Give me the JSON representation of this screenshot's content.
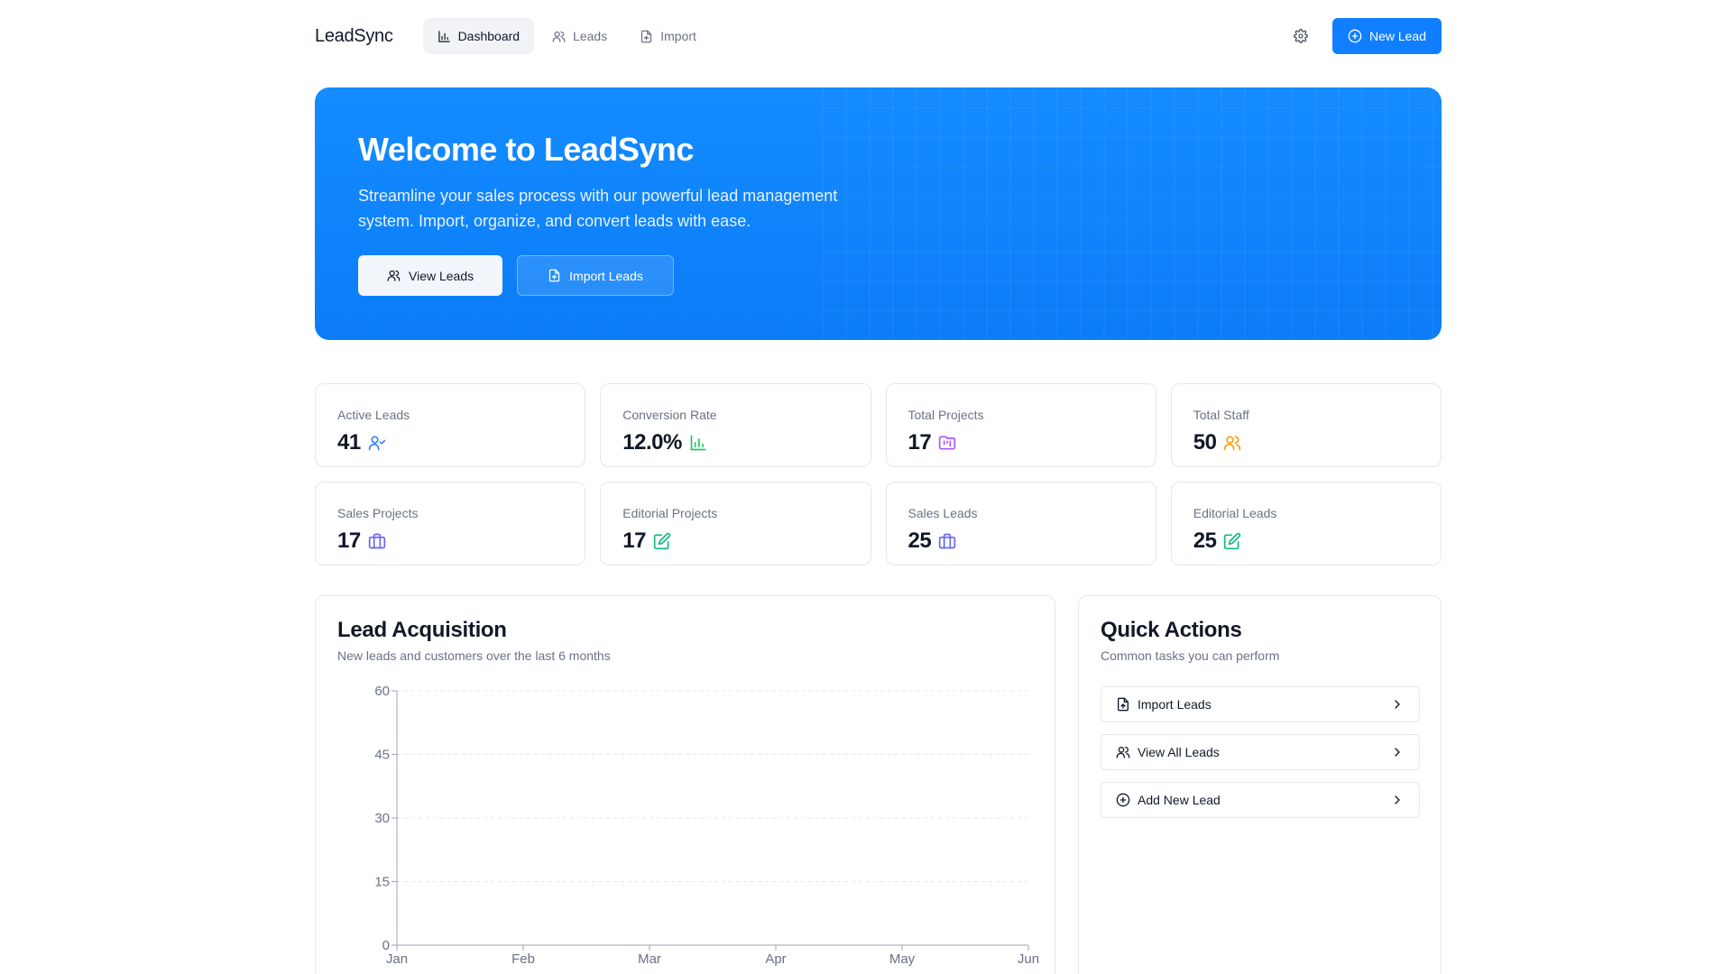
{
  "nav": {
    "brand": "LeadSync",
    "tabs": [
      {
        "label": "Dashboard",
        "icon": "bar-chart-icon",
        "active": true
      },
      {
        "label": "Leads",
        "icon": "users-icon",
        "active": false
      },
      {
        "label": "Import",
        "icon": "file-import-icon",
        "active": false
      }
    ],
    "new_lead_label": "New Lead"
  },
  "hero": {
    "title": "Welcome to LeadSync",
    "subtitle": "Streamline your sales process with our powerful lead management system. Import, organize, and convert leads with ease.",
    "view_leads_label": "View Leads",
    "import_leads_label": "Import Leads"
  },
  "stats": [
    {
      "label": "Active Leads",
      "value": "41",
      "icon": "user-check-icon",
      "color": "#3b82f6"
    },
    {
      "label": "Conversion Rate",
      "value": "12.0%",
      "icon": "bar-chart-icon",
      "color": "#22c55e"
    },
    {
      "label": "Total Projects",
      "value": "17",
      "icon": "folder-kanban-icon",
      "color": "#a855f7"
    },
    {
      "label": "Total Staff",
      "value": "50",
      "icon": "users-icon",
      "color": "#f59e0b"
    },
    {
      "label": "Sales Projects",
      "value": "17",
      "icon": "briefcase-icon",
      "color": "#6366f1"
    },
    {
      "label": "Editorial Projects",
      "value": "17",
      "icon": "edit-icon",
      "color": "#10b981"
    },
    {
      "label": "Sales Leads",
      "value": "25",
      "icon": "briefcase-icon",
      "color": "#6366f1"
    },
    {
      "label": "Editorial Leads",
      "value": "25",
      "icon": "edit-icon",
      "color": "#10b981"
    }
  ],
  "chart_card": {
    "title": "Lead Acquisition",
    "subtitle": "New leads and customers over the last 6 months"
  },
  "chart_data": {
    "type": "line",
    "categories": [
      "Jan",
      "Feb",
      "Mar",
      "Apr",
      "May",
      "Jun"
    ],
    "series": [],
    "yticks": [
      0,
      15,
      30,
      45,
      60
    ],
    "ylim": [
      0,
      60
    ],
    "grid": true
  },
  "quick_actions": {
    "title": "Quick Actions",
    "subtitle": "Common tasks you can perform",
    "items": [
      {
        "label": "Import Leads",
        "icon": "file-import-icon"
      },
      {
        "label": "View All Leads",
        "icon": "users-icon"
      },
      {
        "label": "Add New Lead",
        "icon": "plus-circle-icon"
      }
    ]
  }
}
